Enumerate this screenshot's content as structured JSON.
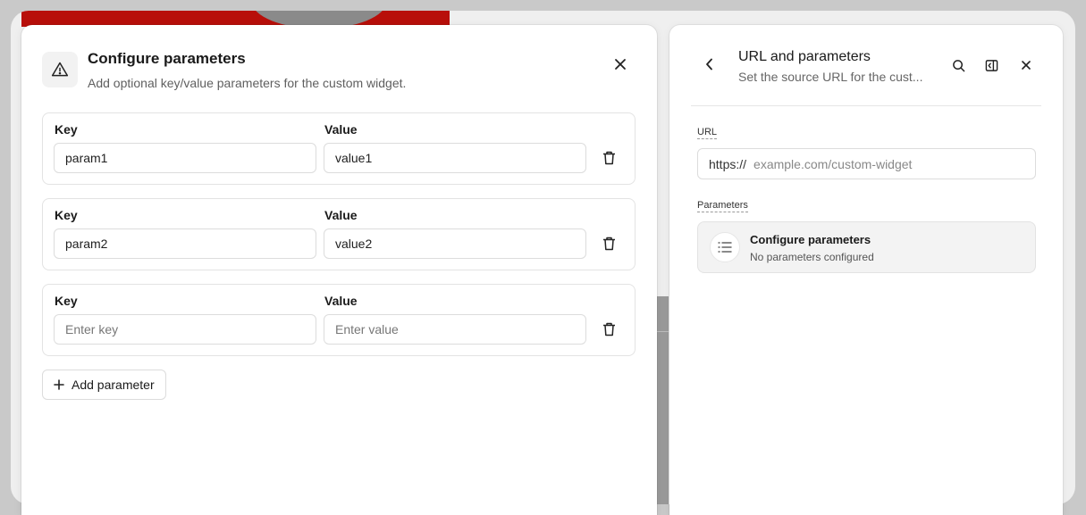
{
  "dialog": {
    "title": "Configure parameters",
    "subtitle": "Add optional key/value parameters for the custom widget.",
    "key_label": "Key",
    "value_label": "Value",
    "params": [
      {
        "key": "param1",
        "value": "value1"
      },
      {
        "key": "param2",
        "value": "value2"
      },
      {
        "key": "",
        "value": "",
        "key_placeholder": "Enter key",
        "value_placeholder": "Enter value"
      }
    ],
    "add_button": "Add parameter"
  },
  "panel": {
    "title": "URL and parameters",
    "subtitle": "Set the source URL for the cust...",
    "url_label": "URL",
    "url_prefix": "https://",
    "url_placeholder": "example.com/custom-widget",
    "parameters_label": "Parameters",
    "configure_title": "Configure parameters",
    "configure_status": "No parameters configured"
  },
  "icons": {
    "dialog": "warning-triangle-icon",
    "close": "close-icon",
    "trash": "trash-icon",
    "plus": "plus-icon",
    "back": "chevron-left-icon",
    "search": "search-icon",
    "panel_toggle": "sidebar-collapse-icon",
    "list": "list-icon"
  },
  "colors": {
    "accent_red": "#b80f0a",
    "card_bg": "#f3f3f3",
    "border": "#e3e3e3"
  }
}
